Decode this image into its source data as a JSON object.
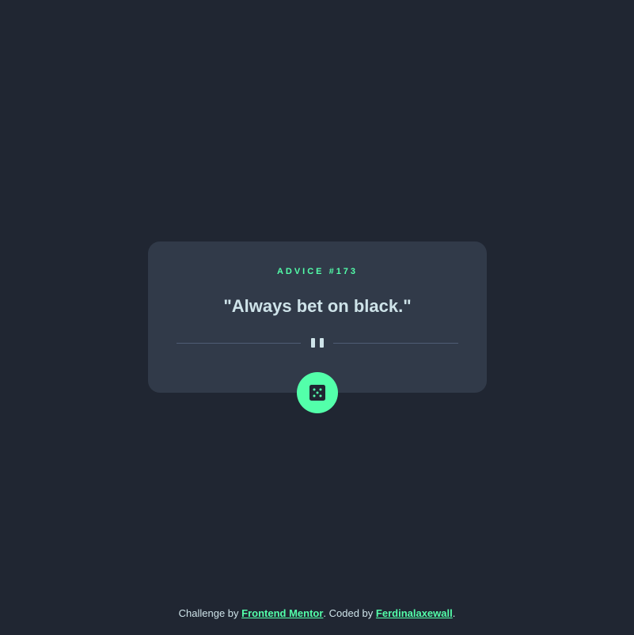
{
  "card": {
    "advice_label": "ADVICE #173",
    "quote": "\"Always bet on black.\""
  },
  "divider": {
    "icon": "pause-icon"
  },
  "dice_button": {
    "icon": "dice-icon"
  },
  "footer": {
    "prefix": "Challenge by ",
    "mentor_link": "Frontend Mentor",
    "middle": ". Coded by ",
    "author_link": "Ferdinalaxewall",
    "suffix": "."
  },
  "colors": {
    "background": "#202632",
    "card": "#313a49",
    "accent": "#53ffaa",
    "text": "#cee3e9",
    "divider": "#4f5d74"
  }
}
